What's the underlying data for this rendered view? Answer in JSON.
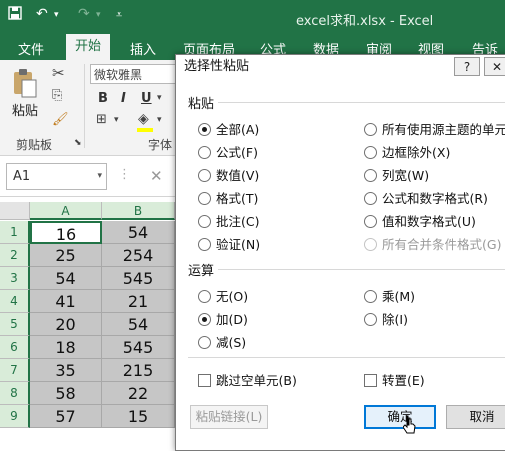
{
  "window": {
    "title": "excel求和.xlsx - Excel"
  },
  "ribbon": {
    "tabs": [
      "文件",
      "开始",
      "插入",
      "页面布局",
      "公式",
      "数据",
      "审阅",
      "视图",
      "告诉"
    ],
    "active_tab": "开始",
    "font_name": "微软雅黑",
    "paste_label": "粘贴",
    "clipboard_group": "剪贴板",
    "font_group": "字体",
    "bold": "B",
    "italic": "I",
    "underline": "U"
  },
  "formula_bar": {
    "name_box": "A1",
    "cancel": "✕"
  },
  "sheet": {
    "columns": [
      "A",
      "B"
    ],
    "rows": [
      {
        "n": "1",
        "a": "16",
        "b": "54"
      },
      {
        "n": "2",
        "a": "25",
        "b": "254"
      },
      {
        "n": "3",
        "a": "54",
        "b": "545"
      },
      {
        "n": "4",
        "a": "41",
        "b": "21"
      },
      {
        "n": "5",
        "a": "20",
        "b": "54"
      },
      {
        "n": "6",
        "a": "18",
        "b": "545"
      },
      {
        "n": "7",
        "a": "35",
        "b": "215"
      },
      {
        "n": "8",
        "a": "58",
        "b": "22"
      },
      {
        "n": "9",
        "a": "57",
        "b": "15"
      }
    ]
  },
  "dialog": {
    "title": "选择性粘贴",
    "help": "?",
    "close": "✕",
    "paste_section": "粘贴",
    "paste_left": [
      "全部(A)",
      "公式(F)",
      "数值(V)",
      "格式(T)",
      "批注(C)",
      "验证(N)"
    ],
    "paste_right": [
      "所有使用源主题的单元",
      "边框除外(X)",
      "列宽(W)",
      "公式和数字格式(R)",
      "值和数字格式(U)",
      "所有合并条件格式(G)"
    ],
    "operation_section": "运算",
    "op_left": [
      "无(O)",
      "加(D)",
      "减(S)"
    ],
    "op_right": [
      "乘(M)",
      "除(I)"
    ],
    "skip_blanks": "跳过空单元(B)",
    "transpose": "转置(E)",
    "paste_link": "粘贴链接(L)",
    "ok": "确定",
    "cancel": "取消"
  }
}
